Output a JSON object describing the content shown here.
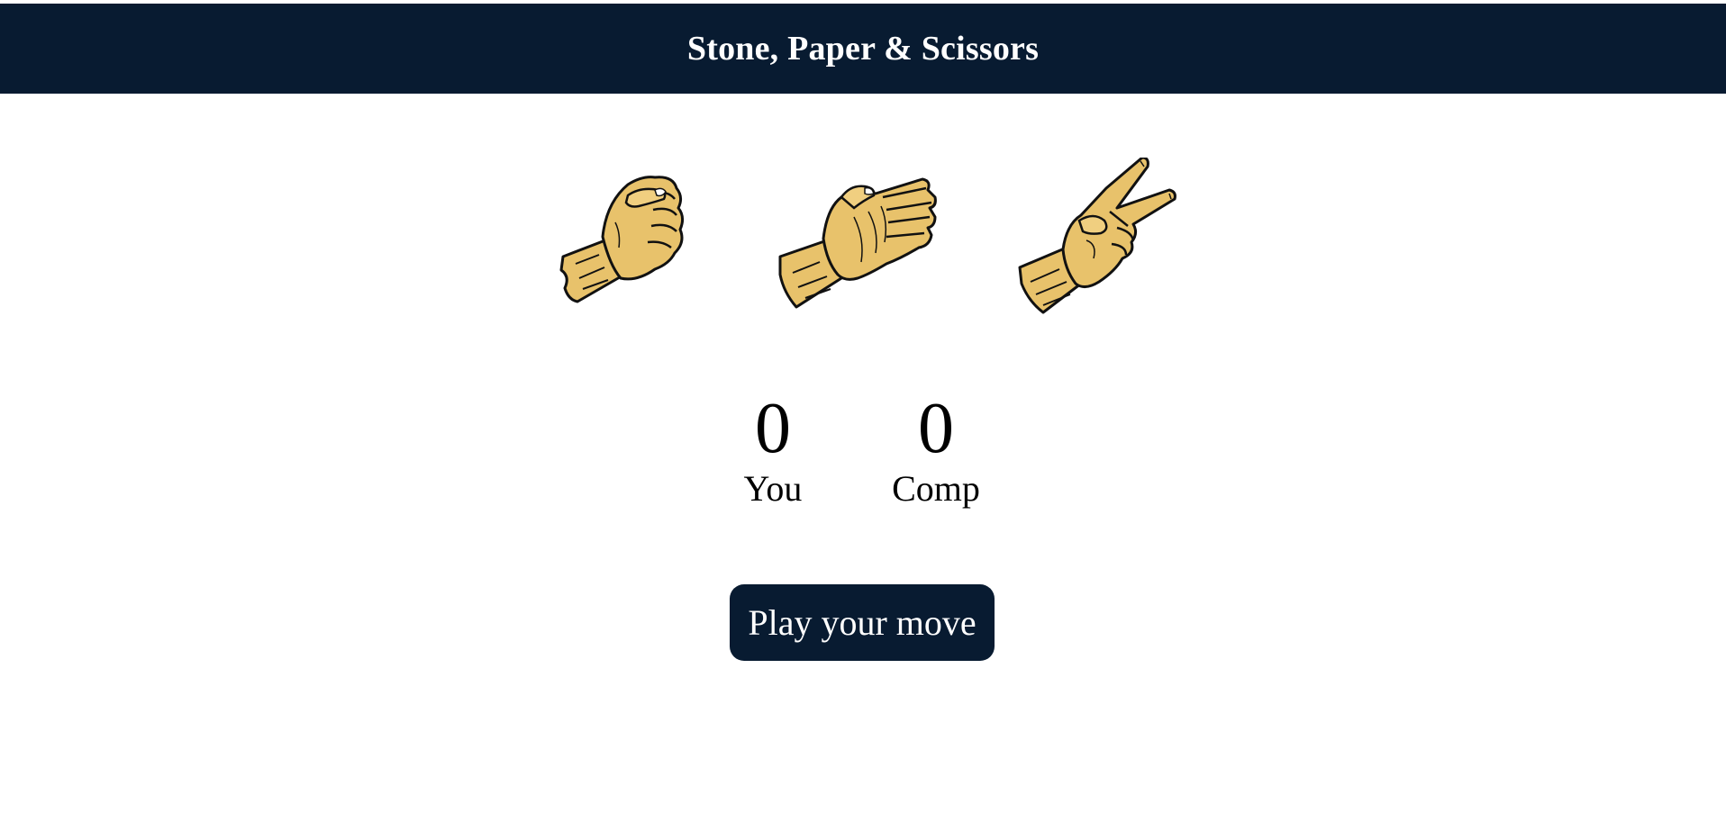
{
  "header": {
    "title": "Stone, Paper & Scissors"
  },
  "choices": [
    {
      "id": "rock",
      "icon": "fist-hand-icon"
    },
    {
      "id": "paper",
      "icon": "open-palm-hand-icon"
    },
    {
      "id": "scissors",
      "icon": "peace-sign-hand-icon"
    }
  ],
  "scoreboard": {
    "user": {
      "score": "0",
      "label": "You"
    },
    "comp": {
      "score": "0",
      "label": "Comp"
    }
  },
  "message": {
    "text": "Play your move"
  },
  "colors": {
    "header_bg": "#081b31",
    "button_bg": "#081b31",
    "skin": "#e8c26b",
    "outline": "#111111"
  }
}
